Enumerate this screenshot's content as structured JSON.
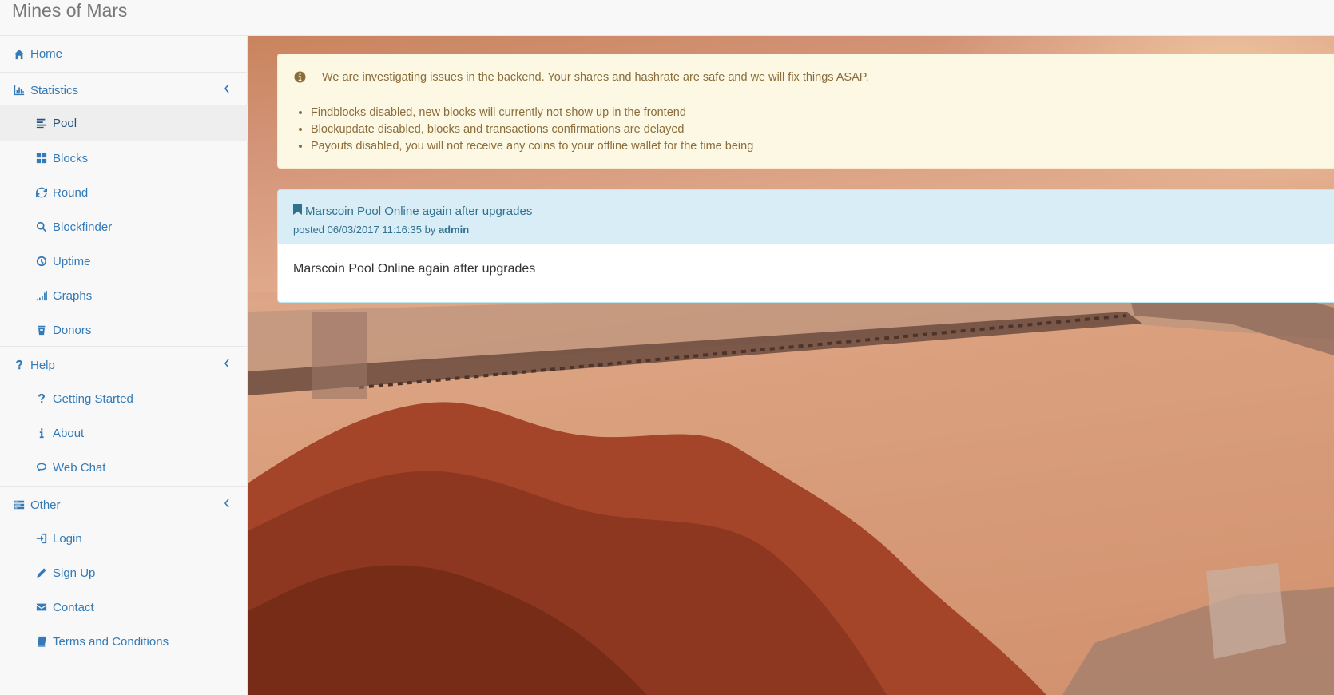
{
  "brand": "Mines of Mars",
  "sidebar": {
    "home": "Home",
    "statistics": "Statistics",
    "statistics_items": [
      "Pool",
      "Blocks",
      "Round",
      "Blockfinder",
      "Uptime",
      "Graphs",
      "Donors"
    ],
    "help": "Help",
    "help_items": [
      "Getting Started",
      "About",
      "Web Chat"
    ],
    "other": "Other",
    "other_items": [
      "Login",
      "Sign Up",
      "Contact",
      "Terms and Conditions"
    ],
    "active_item": "Pool"
  },
  "alert": {
    "message": "We are investigating issues in the backend. Your shares and hashrate are safe and we will fix things ASAP.",
    "items": [
      "Findblocks disabled, new blocks will currently not show up in the frontend",
      "Blockupdate disabled, blocks and transactions confirmations are delayed",
      "Payouts disabled, you will not receive any coins to your offline wallet for the time being"
    ]
  },
  "news": {
    "title": "Marscoin Pool Online again after upgrades",
    "posted_prefix": "posted 06/03/2017 11:16:35 by",
    "author": "admin",
    "body": "Marscoin Pool Online again after upgrades"
  },
  "colors": {
    "link": "#337ab7",
    "alert_bg": "#fcf8e3",
    "panel_heading_bg": "#d9edf7"
  }
}
